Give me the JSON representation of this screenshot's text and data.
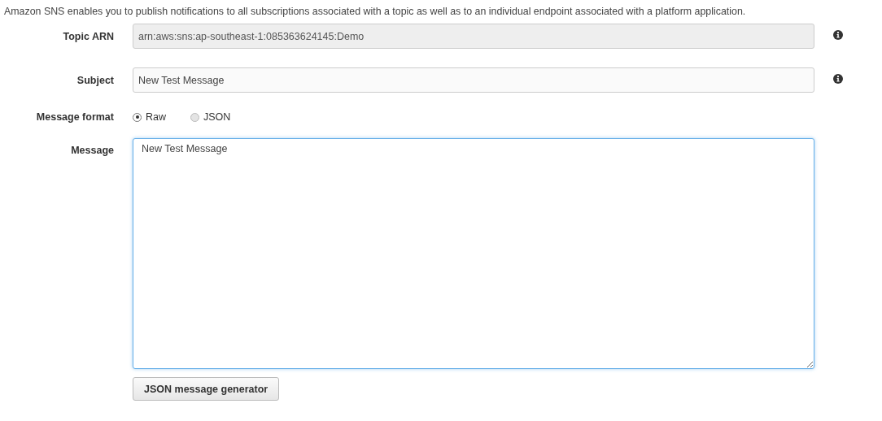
{
  "intro": "Amazon SNS enables you to publish notifications to all subscriptions associated with a topic as well as to an individual endpoint associated with a platform application.",
  "fields": [
    {
      "kind": "text",
      "label": "Topic ARN",
      "value": "arn:aws:sns:ap-southeast-1:085363624145:Demo",
      "disabled": true,
      "info": true
    },
    {
      "kind": "text",
      "label": "Subject",
      "value": "New Test Message",
      "disabled": false,
      "info": true
    },
    {
      "kind": "radio",
      "label": "Message format",
      "options": [
        {
          "label": "Raw",
          "selected": true
        },
        {
          "label": "JSON",
          "selected": false
        }
      ]
    },
    {
      "kind": "textarea",
      "label": "Message",
      "value": "New Test Message",
      "focused": true
    }
  ],
  "button": "JSON message generator"
}
